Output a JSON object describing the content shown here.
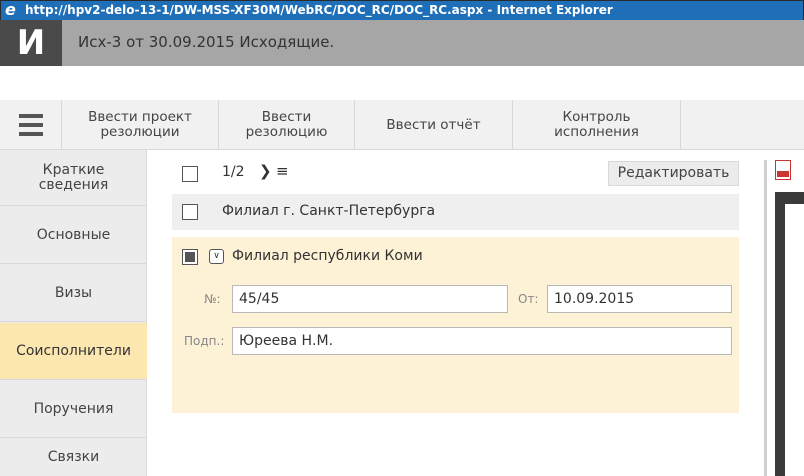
{
  "window": {
    "title": "http://hpv2-delo-13-1/DW-MSS-XF30M/WebRC/DOC_RC/DOC_RC.aspx - Internet Explorer",
    "icon": "internet-explorer-icon"
  },
  "app": {
    "logo": "И",
    "doc_title": "Исх-3 от 30.09.2015  Исходящие."
  },
  "toolbar": {
    "menu_icon": "hamburger-menu-icon",
    "buttons": [
      {
        "label": "Ввести проект\nрезолюции"
      },
      {
        "label": "Ввести\nрезолюцию"
      },
      {
        "label": "Ввести отчёт"
      },
      {
        "label": "Контроль\nисполнения"
      }
    ]
  },
  "nav": {
    "items": [
      {
        "label": "Краткие\nсведения",
        "active": false
      },
      {
        "label": "Основные",
        "active": false
      },
      {
        "label": "Визы",
        "active": false
      },
      {
        "label": "Соисполнители",
        "active": true
      },
      {
        "label": "Поручения",
        "active": false
      },
      {
        "label": "Связки",
        "active": false
      }
    ]
  },
  "main": {
    "pager": "1/2",
    "next_icon": "chevron-right-icon",
    "list_icon": "list-icon",
    "edit_label": "Редактировать",
    "rows": [
      {
        "name": "Филиал г. Санкт-Петербурга",
        "checked": false
      }
    ],
    "selected": {
      "name": "Филиал республики Коми",
      "expand_icon": "chevron-down-icon",
      "number_label": "№:",
      "number_value": "45/45",
      "date_label": "От:",
      "date_value": "10.09.2015",
      "signer_label": "Подп.:",
      "signer_value": "Юреева Н.М."
    }
  },
  "right_pane": {
    "icon": "pdf-icon"
  },
  "colors": {
    "title_bar": "#1f6fb8",
    "header_bg": "#a6a6a6",
    "logo_bg": "#4a4a4a",
    "active_nav": "#fde7b0",
    "selected_row": "#fdf1d6"
  }
}
